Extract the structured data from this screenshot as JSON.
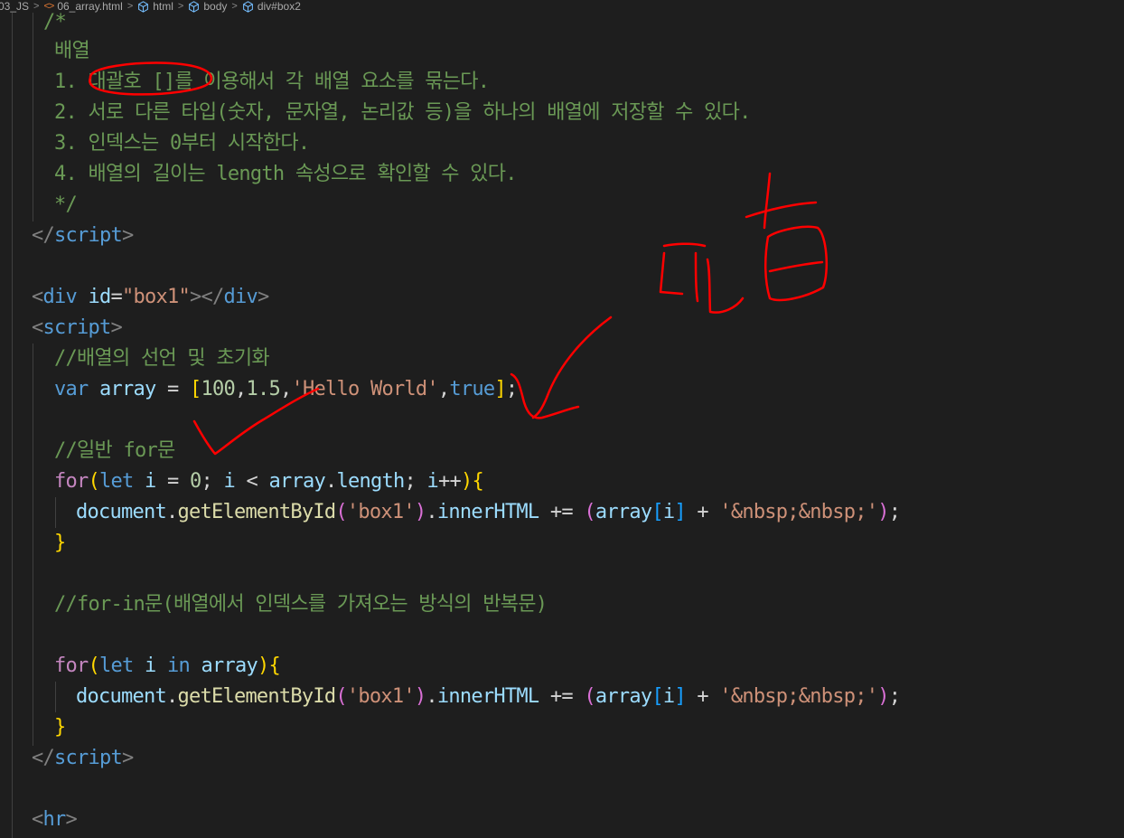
{
  "breadcrumb": {
    "folder": "03_JS",
    "file": "06_array.html",
    "items": [
      "html",
      "body",
      "div#box2"
    ]
  },
  "code": {
    "comment_open": "/*",
    "comment_title": "배열",
    "comment_1": "1. 대괄호 []를 이용해서 각 배열 요소를 묶는다.",
    "comment_2": "2. 서로 다른 타입(숫자, 문자열, 논리값 등)을 하나의 배열에 저장할 수 있다.",
    "comment_3": "3. 인덱스는 0부터 시작한다.",
    "comment_4": "4. 배열의 길이는 length 속성으로 확인할 수 있다.",
    "comment_close": "*/",
    "script_tag": "script",
    "div_tag": "div",
    "id_attr": "id",
    "box_id": "\"box1\"",
    "decl_comment": "//배열의 선언 및 초기화",
    "var_kw": "var",
    "array_name": "array",
    "num_100": "100",
    "num_15": "1.5",
    "str_hello": "'Hello World'",
    "bool_true": "true",
    "for_comment": "//일반 for문",
    "for_kw": "for",
    "let_kw": "let",
    "i_var": "i",
    "zero": "0",
    "length_prop": "length",
    "document_obj": "document",
    "get_fn": "getElementById",
    "box1_str": "'box1'",
    "inner_prop": "innerHTML",
    "nbsp_str": "'&nbsp;&nbsp;'",
    "forin_comment": "//for-in문(배열에서 인덱스를 가져오는 방식의 반복문)",
    "in_kw": "in",
    "hr_tag": "hr"
  },
  "annotations": {
    "handwriting": "괜찮",
    "ink_color": "#ff0000"
  },
  "colors": {
    "background": "#1e1e1e",
    "comment": "#6a9955",
    "keyword": "#569cd6",
    "control": "#c586c0",
    "variable": "#9cdcfe",
    "string": "#ce9178",
    "number": "#b5cea8",
    "function": "#dcdcaa"
  }
}
